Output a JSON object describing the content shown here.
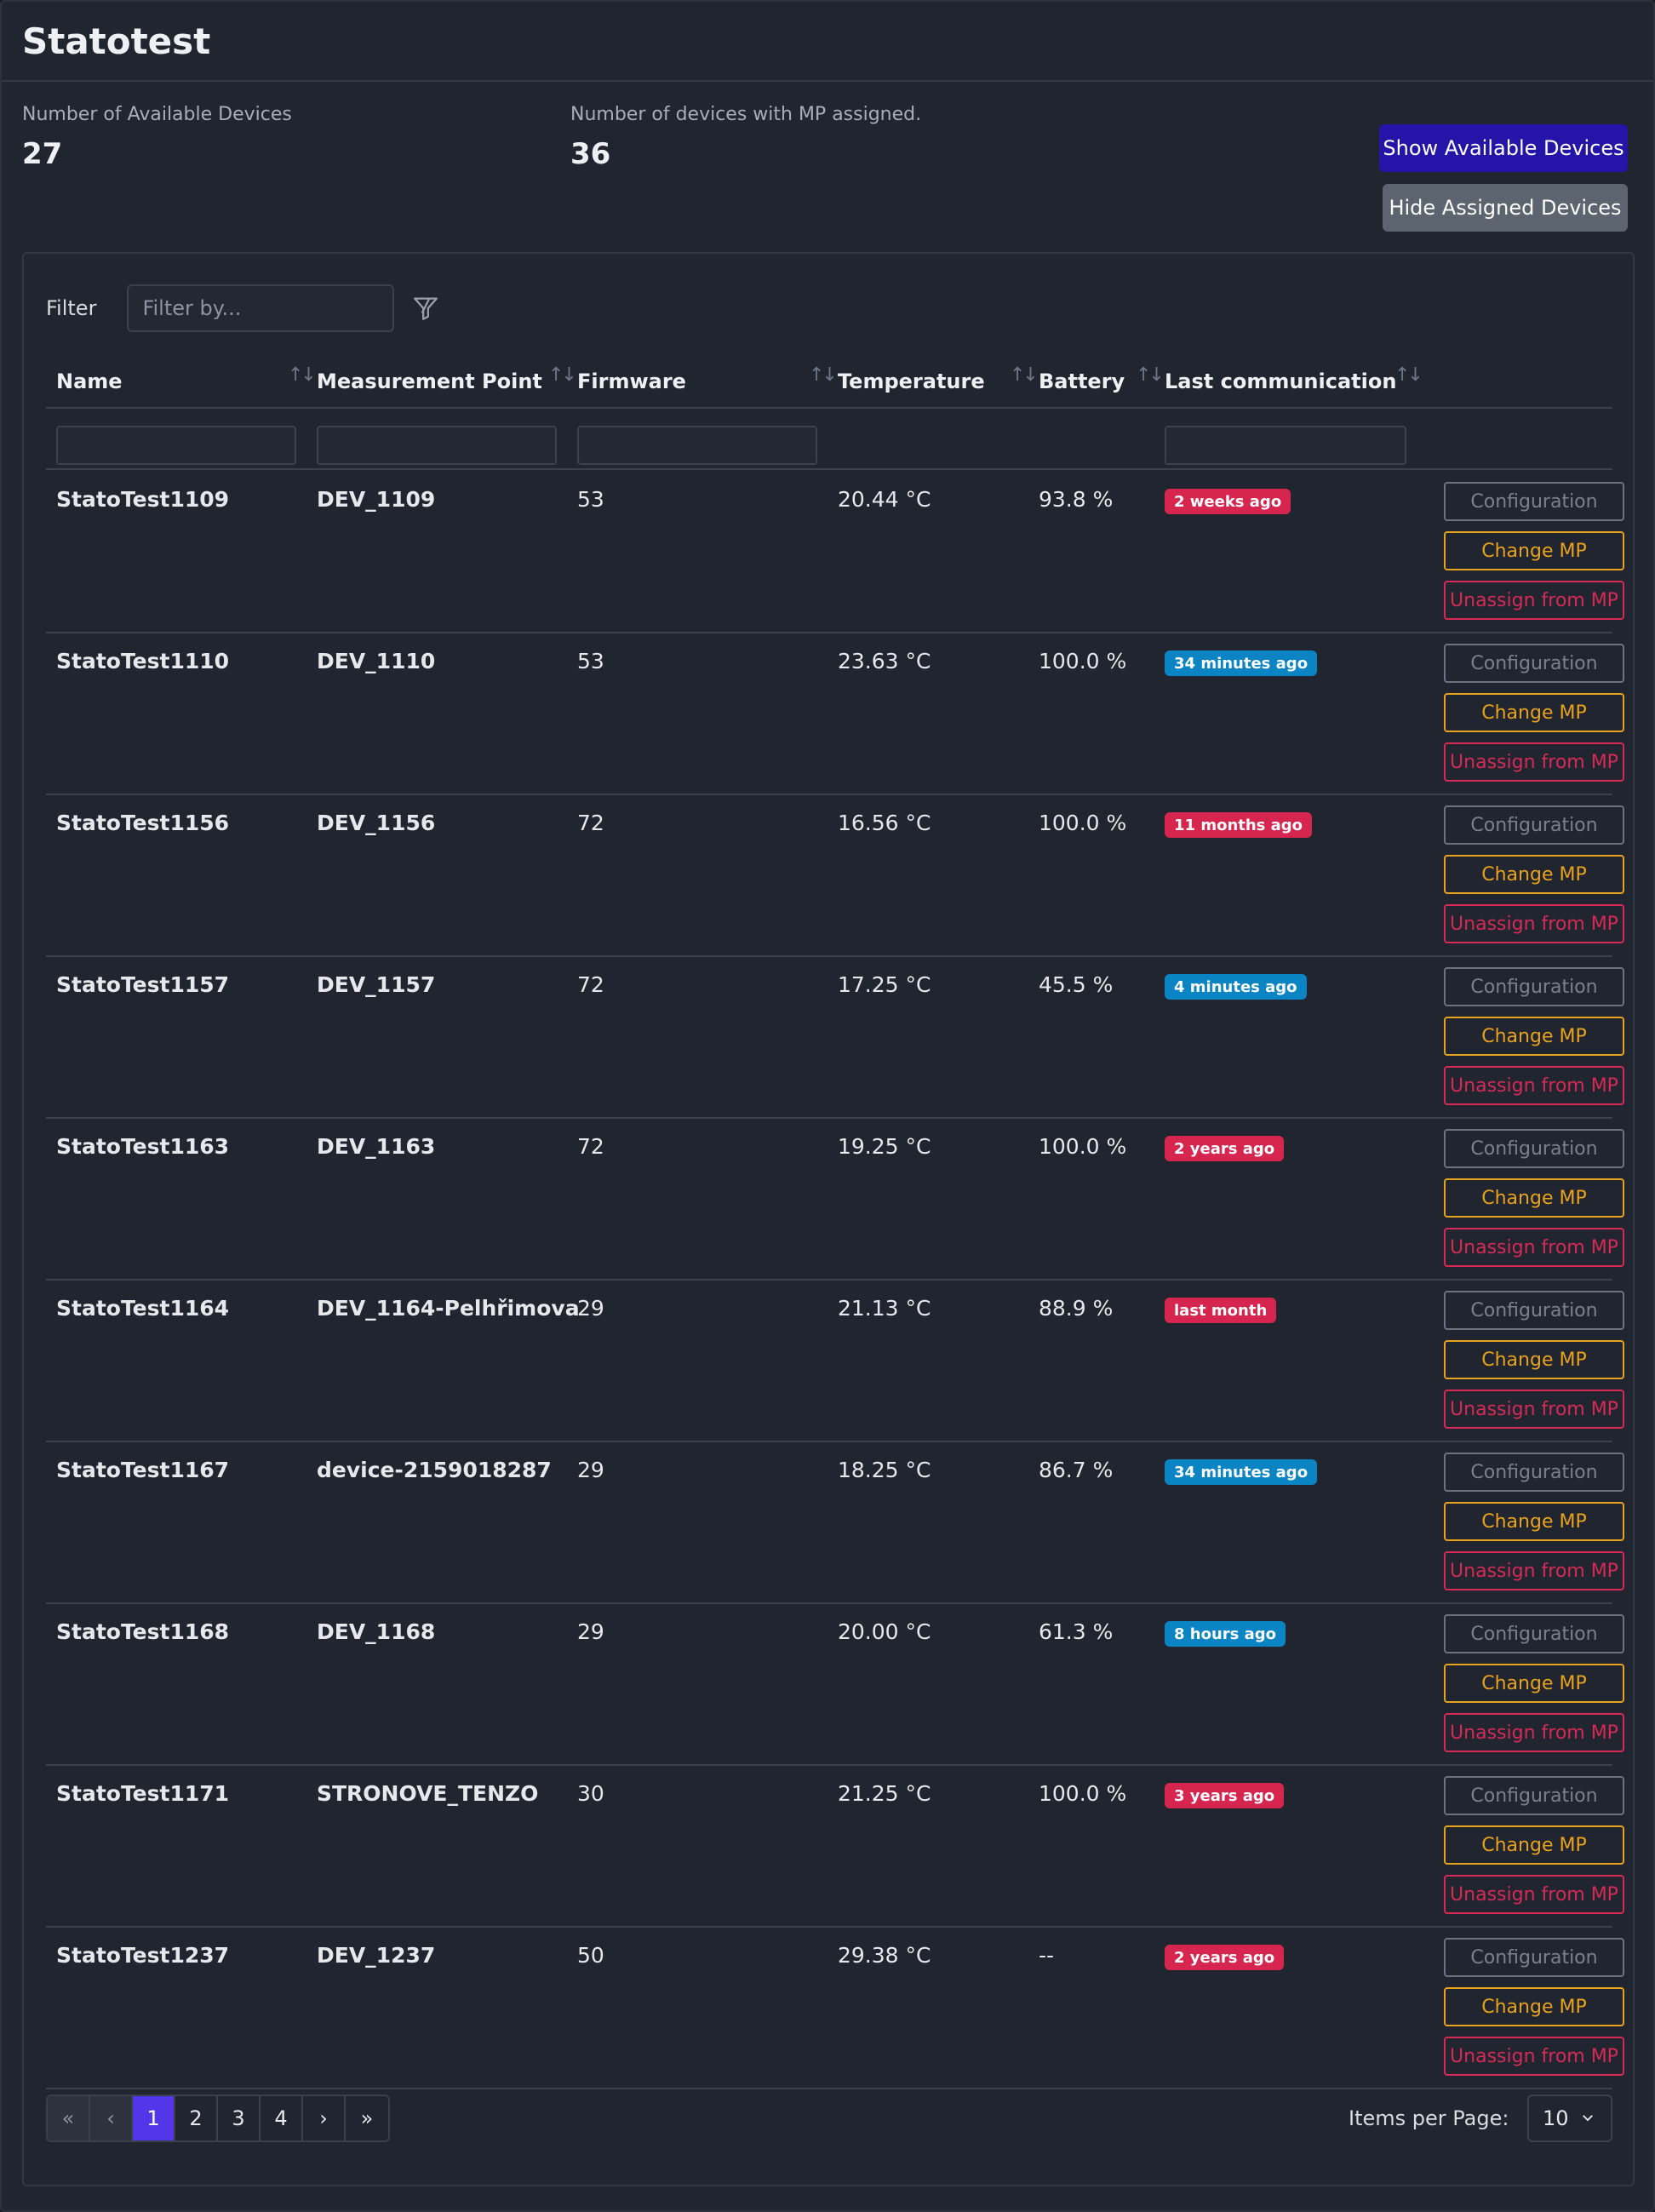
{
  "app": {
    "title": "Statotest"
  },
  "stats": {
    "available_label": "Number of Available Devices",
    "available_value": "27",
    "assigned_label": "Number of devices with MP assigned.",
    "assigned_value": "36"
  },
  "actions": {
    "show_available": "Show Available Devices",
    "hide_assigned": "Hide Assigned Devices"
  },
  "filter": {
    "label": "Filter",
    "placeholder": "Filter by..."
  },
  "columns": {
    "name": "Name",
    "mp": "Measurement Point",
    "firmware": "Firmware",
    "temperature": "Temperature",
    "battery": "Battery",
    "last_comm": "Last communication"
  },
  "row_actions": {
    "configuration": "Configuration",
    "change_mp": "Change MP",
    "unassign": "Unassign from MP"
  },
  "rows": [
    {
      "name": "StatoTest1109",
      "mp": "DEV_1109",
      "firmware": "53",
      "temperature": "20.44 °C",
      "battery": "93.8 %",
      "last_comm": "2 weeks ago",
      "status": "red"
    },
    {
      "name": "StatoTest1110",
      "mp": "DEV_1110",
      "firmware": "53",
      "temperature": "23.63 °C",
      "battery": "100.0 %",
      "last_comm": "34 minutes ago",
      "status": "blue"
    },
    {
      "name": "StatoTest1156",
      "mp": "DEV_1156",
      "firmware": "72",
      "temperature": "16.56 °C",
      "battery": "100.0 %",
      "last_comm": "11 months ago",
      "status": "red"
    },
    {
      "name": "StatoTest1157",
      "mp": "DEV_1157",
      "firmware": "72",
      "temperature": "17.25 °C",
      "battery": "45.5 %",
      "last_comm": "4 minutes ago",
      "status": "blue"
    },
    {
      "name": "StatoTest1163",
      "mp": "DEV_1163",
      "firmware": "72",
      "temperature": "19.25 °C",
      "battery": "100.0 %",
      "last_comm": "2 years ago",
      "status": "red"
    },
    {
      "name": "StatoTest1164",
      "mp": "DEV_1164-Pelhřimova",
      "firmware": "29",
      "temperature": "21.13 °C",
      "battery": "88.9 %",
      "last_comm": "last month",
      "status": "red"
    },
    {
      "name": "StatoTest1167",
      "mp": "device-2159018287",
      "firmware": "29",
      "temperature": "18.25 °C",
      "battery": "86.7 %",
      "last_comm": "34 minutes ago",
      "status": "blue"
    },
    {
      "name": "StatoTest1168",
      "mp": "DEV_1168",
      "firmware": "29",
      "temperature": "20.00 °C",
      "battery": "61.3 %",
      "last_comm": "8 hours ago",
      "status": "blue"
    },
    {
      "name": "StatoTest1171",
      "mp": "STRONOVE_TENZO",
      "firmware": "30",
      "temperature": "21.25 °C",
      "battery": "100.0 %",
      "last_comm": "3 years ago",
      "status": "red"
    },
    {
      "name": "StatoTest1237",
      "mp": "DEV_1237",
      "firmware": "50",
      "temperature": "29.38 °C",
      "battery": "--",
      "last_comm": "2 years ago",
      "status": "red"
    }
  ],
  "pagination": {
    "first": "«",
    "prev": "‹",
    "pages": [
      "1",
      "2",
      "3",
      "4"
    ],
    "current": "1",
    "next": "›",
    "last": "»"
  },
  "items_per_page": {
    "label": "Items per Page:",
    "value": "10"
  }
}
